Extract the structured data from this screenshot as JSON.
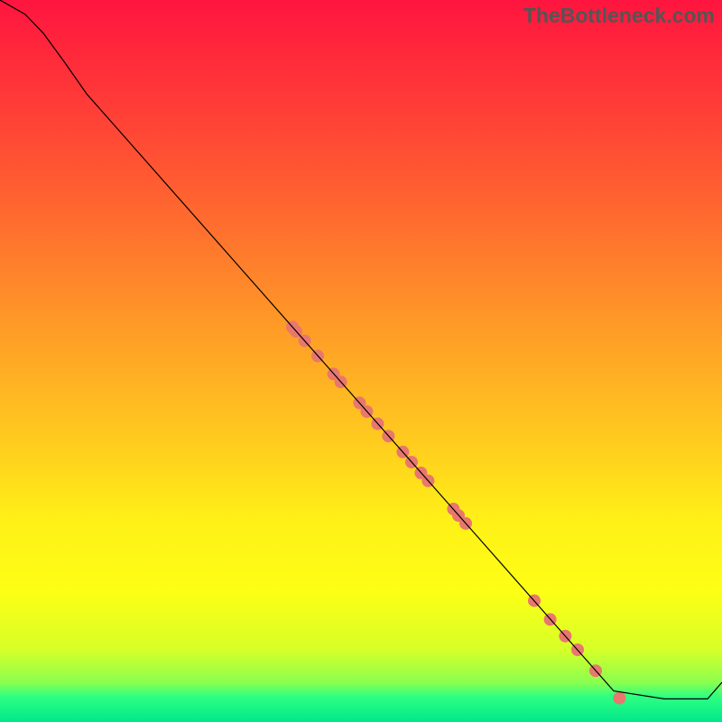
{
  "watermark": "TheBottleneck.com",
  "chart_data": {
    "type": "line",
    "title": "",
    "xlabel": "",
    "ylabel": "",
    "xlim": [
      0,
      100
    ],
    "ylim": [
      0,
      100
    ],
    "background_gradient": {
      "stops": [
        {
          "offset": 0.0,
          "color": "#ff153f"
        },
        {
          "offset": 0.15,
          "color": "#ff3d37"
        },
        {
          "offset": 0.3,
          "color": "#ff6a2f"
        },
        {
          "offset": 0.45,
          "color": "#ff9a27"
        },
        {
          "offset": 0.6,
          "color": "#ffc81f"
        },
        {
          "offset": 0.72,
          "color": "#fff017"
        },
        {
          "offset": 0.82,
          "color": "#fdff15"
        },
        {
          "offset": 0.9,
          "color": "#d6ff28"
        },
        {
          "offset": 0.945,
          "color": "#8bff4f"
        },
        {
          "offset": 0.965,
          "color": "#2eff82"
        },
        {
          "offset": 1.0,
          "color": "#00e78a"
        }
      ]
    },
    "series": [
      {
        "name": "curve",
        "x": [
          0.0,
          3.5,
          6.0,
          9.0,
          12.0,
          85.0,
          92.0,
          98.0,
          100.0
        ],
        "y": [
          100.0,
          98.0,
          95.4,
          91.3,
          87.0,
          4.3,
          3.2,
          3.2,
          5.5
        ],
        "stroke": "#000000",
        "stroke_width": 1.2
      }
    ],
    "scatter": {
      "name": "markers",
      "color": "#e8776e",
      "radius": 7,
      "points": [
        {
          "x": 40.5,
          "y": 54.7
        },
        {
          "x": 41.0,
          "y": 54.1
        },
        {
          "x": 42.2,
          "y": 52.8
        },
        {
          "x": 44.0,
          "y": 50.7
        },
        {
          "x": 46.2,
          "y": 48.2
        },
        {
          "x": 47.2,
          "y": 47.1
        },
        {
          "x": 49.8,
          "y": 44.2
        },
        {
          "x": 50.8,
          "y": 43.0
        },
        {
          "x": 52.3,
          "y": 41.3
        },
        {
          "x": 53.8,
          "y": 39.6
        },
        {
          "x": 55.8,
          "y": 37.4
        },
        {
          "x": 57.0,
          "y": 36.0
        },
        {
          "x": 58.3,
          "y": 34.5
        },
        {
          "x": 59.3,
          "y": 33.4
        },
        {
          "x": 62.8,
          "y": 29.5
        },
        {
          "x": 63.5,
          "y": 28.6
        },
        {
          "x": 64.5,
          "y": 27.5
        },
        {
          "x": 74.0,
          "y": 16.8
        },
        {
          "x": 76.2,
          "y": 14.2
        },
        {
          "x": 78.3,
          "y": 11.9
        },
        {
          "x": 80.0,
          "y": 10.0
        },
        {
          "x": 82.5,
          "y": 7.1
        },
        {
          "x": 85.8,
          "y": 3.3
        }
      ]
    }
  }
}
